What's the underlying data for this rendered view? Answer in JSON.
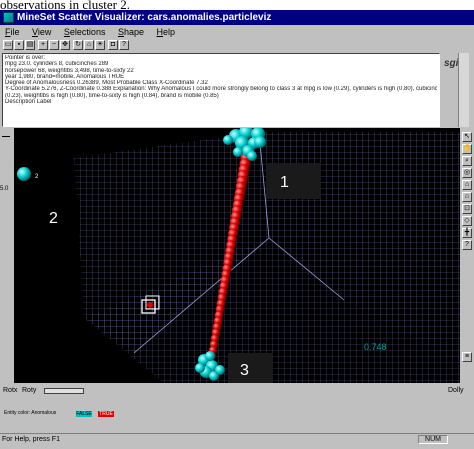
{
  "caption": "observations in cluster 2.",
  "window": {
    "title": "MineSet Scatter Visualizer: cars.anomalies.particleviz"
  },
  "menu": [
    "File",
    "View",
    "Selections",
    "Shape",
    "Help"
  ],
  "toolbar": [
    "open-icon",
    "save-icon",
    "print-icon",
    "zoom-in-icon",
    "zoom-out-icon",
    "pan-icon",
    "rotate-icon",
    "home-icon",
    "light-icon",
    "camera-icon",
    "grid-icon",
    "cube-icon",
    "help-icon"
  ],
  "info": {
    "lines": [
      "Pointer is over:",
      "mpg 23.0, cylinders 8, cubicinches 289",
      "horsepower 68, weightlbs 3,498, time-to-sixty 22",
      "year 1,980, brand=mobile, Anomalous TRUE",
      "Degree of Anomalousness 0.26389, Most Probable Class X-Coordinate 7.32",
      "Y-Coordinate 5.276, Z-Coordinate 0.388  Explanation: Why Anomalous I could more strongly belong to class 3 at mpg is low (0.29), cylinders is high (0.80), cubicinches is high (0.82), horsepower is low",
      "(0.23), weightlbs is high (0.80), time-to-sixty is high (0.84), brand is mobile (0.85)",
      "Description Label"
    ],
    "logo": "sgi"
  },
  "scene": {
    "labels": [
      "1",
      "2",
      "3"
    ],
    "legend_sphere_label": "2",
    "axis_value": "5.0",
    "axis_tick_right": "0.748"
  },
  "controls": {
    "rotx_label": "Rotx",
    "roty_label": "Roty",
    "dolly_label": "Dolly",
    "entity_color_label": "Entity color: Anomalous",
    "false_label": "FALSE",
    "true_label": "TRUE"
  },
  "status": {
    "left": "For Help, press F1",
    "right": "NUM"
  },
  "colors": {
    "cluster": "#00d8d8",
    "anomaly": "#e00000",
    "grid": "#8080c8"
  }
}
